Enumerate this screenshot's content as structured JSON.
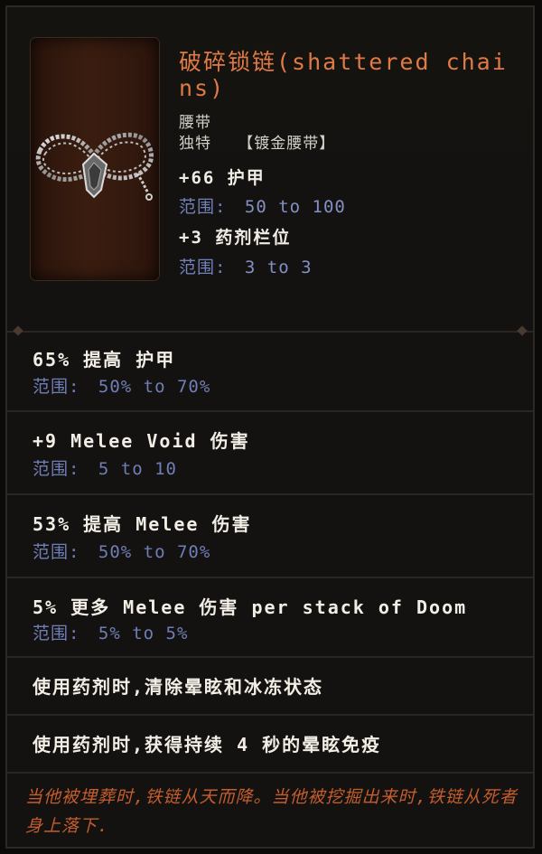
{
  "item": {
    "name": "破碎锁链(shattered chains)",
    "base_type": "腰带",
    "rarity": "独特",
    "subtype": "【镀金腰带】",
    "implicits": [
      {
        "stat": "+66 护甲",
        "range_label": "范围:",
        "range_value": "50 to 100"
      },
      {
        "stat": "+3 药剂栏位",
        "range_label": "范围:",
        "range_value": "3 to 3"
      }
    ]
  },
  "affixes": [
    {
      "stat": "65% 提高 护甲",
      "range_label": "范围:",
      "range_value": "50% to 70%"
    },
    {
      "stat": "+9 Melee Void 伤害",
      "range_label": "范围:",
      "range_value": "5 to 10"
    },
    {
      "stat": "53% 提高 Melee 伤害",
      "range_label": "范围:",
      "range_value": "50% to 70%"
    },
    {
      "stat": "5% 更多 Melee 伤害 per stack of Doom",
      "range_label": "范围:",
      "range_value": "5% to 5%"
    },
    {
      "stat": "使用药剂时,清除晕眩和冰冻状态"
    },
    {
      "stat": "使用药剂时,获得持续 4 秒的晕眩免疫"
    }
  ],
  "lore": "当他被埋葬时,铁链从天而降。当他被挖掘出来时,铁链从死者身上落下.",
  "colors": {
    "title": "#e07a45",
    "range": "#6f7eb6",
    "lore": "#c45d2e",
    "background": "#14120f"
  },
  "icons": {
    "item_art": "chain-belt-icon"
  }
}
